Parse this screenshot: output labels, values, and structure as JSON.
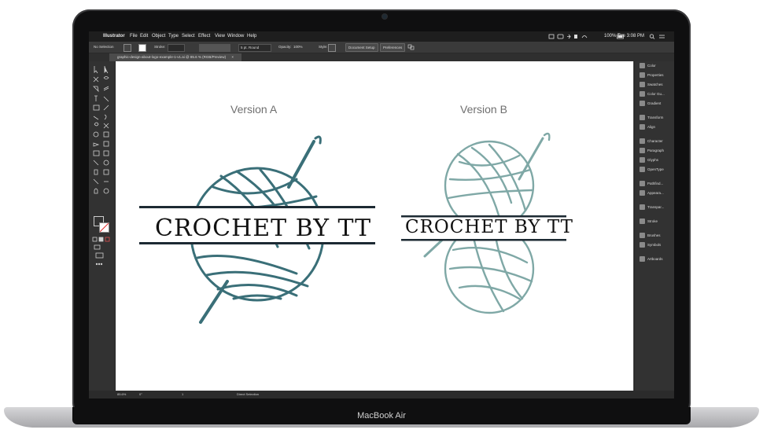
{
  "mac": {
    "brand": "MacBook Air"
  },
  "menubar": {
    "app": "Illustrator",
    "items": [
      "File",
      "Edit",
      "Object",
      "Type",
      "Select",
      "Effect",
      "View",
      "Window",
      "Help"
    ],
    "battery": "100%",
    "time": "Tue 3:08 PM"
  },
  "controlbar": {
    "selection": "No Selection",
    "stroke_label": "Stroke:",
    "brush": "5 pt. Round",
    "opacity_label": "Opacity:",
    "opacity_value": "100%",
    "style_label": "Style:",
    "doc_setup": "Document Setup",
    "preferences": "Preferences"
  },
  "document": {
    "tab": "graphic-design-about-logo-example-1-v1.ai @ 85.6 % (RGB/Preview)",
    "tab_close": "×"
  },
  "panels": {
    "items": [
      "Color",
      "Properties",
      "Swatches",
      "Color Gu...",
      "Gradient",
      "Transform",
      "Align",
      "Character",
      "Paragraph",
      "Glyphs",
      "OpenType",
      "Pathfind...",
      "Appeara...",
      "Transpar...",
      "Stroke",
      "Brushes",
      "Symbols",
      "Artboards"
    ]
  },
  "statusbar": {
    "zoom": "85.6%",
    "rotation": "0°",
    "artboard": "1",
    "tool": "Direct Selection"
  },
  "artwork": {
    "version_a": {
      "label": "Version A",
      "text": "CROCHET BY TT",
      "color": "#3a6f78"
    },
    "version_b": {
      "label": "Version B",
      "text": "CROCHET BY TT",
      "color": "#7fa8a6"
    },
    "logo_bar_color": "#1d2a33",
    "logo_text_color": "#111111"
  },
  "colors": {
    "bezel": "#0f0f10",
    "ui_dark": "#323232",
    "menubar": "#1e1e1e",
    "canvas": "#ffffff"
  }
}
